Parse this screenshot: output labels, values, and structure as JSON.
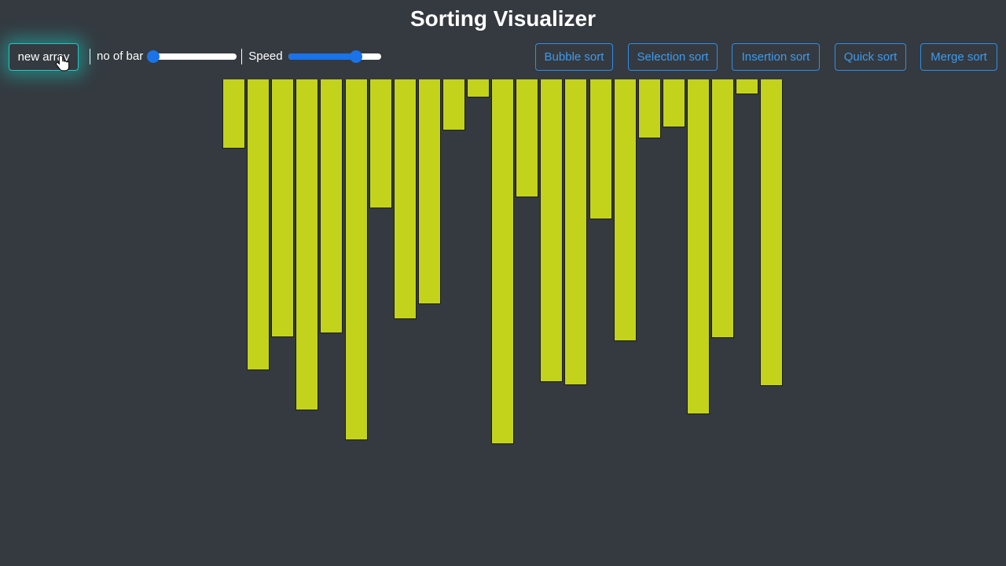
{
  "title": "Sorting Visualizer",
  "controls": {
    "new_array_label": "new array",
    "bars_label": "no of bar",
    "bars_value": 0.05,
    "speed_label": "Speed",
    "speed_value": 0.73
  },
  "sort_buttons": [
    {
      "label": "Bubble sort"
    },
    {
      "label": "Selection sort"
    },
    {
      "label": "Insertion sort"
    },
    {
      "label": "Quick sort"
    },
    {
      "label": "Merge sort"
    }
  ],
  "colors": {
    "background": "#343a40",
    "bar": "#c3d31b",
    "accent_blue": "#1a73e8",
    "glow": "#20c9c0"
  },
  "array_values": [
    88,
    370,
    328,
    421,
    323,
    459,
    164,
    305,
    286,
    65,
    23,
    464,
    150,
    385,
    389,
    178,
    333,
    75,
    61,
    426,
    329,
    19,
    390
  ]
}
